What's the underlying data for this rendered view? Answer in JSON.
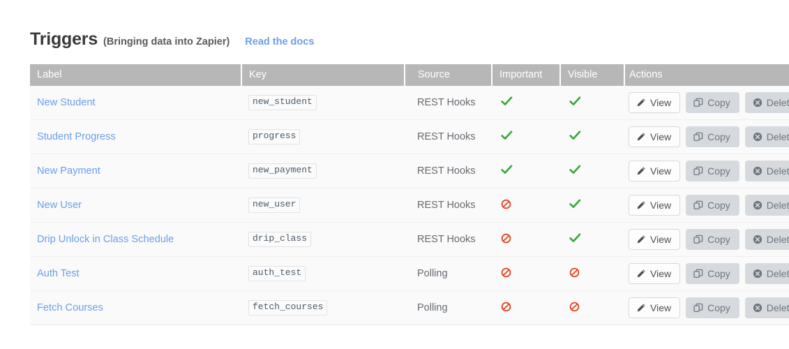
{
  "header": {
    "title": "Triggers",
    "subtitle": "(Bringing data into Zapier)",
    "docs_link": "Read the docs"
  },
  "table": {
    "columns": [
      "Label",
      "Key",
      "Source",
      "Important",
      "Visible",
      "Actions"
    ],
    "actions": {
      "view_label": "View",
      "copy_label": "Copy",
      "delete_label": "Delete",
      "view_icon": "pencil-icon",
      "copy_icon": "copy-icon",
      "delete_icon": "circle-x-icon"
    },
    "icons": {
      "yes": "check-icon",
      "no": "ban-icon"
    },
    "rows": [
      {
        "label": "New Student",
        "key": "new_student",
        "source": "REST Hooks",
        "important": "yes",
        "visible": "yes"
      },
      {
        "label": "Student Progress",
        "key": "progress",
        "source": "REST Hooks",
        "important": "yes",
        "visible": "yes"
      },
      {
        "label": "New Payment",
        "key": "new_payment",
        "source": "REST Hooks",
        "important": "yes",
        "visible": "yes"
      },
      {
        "label": "New User",
        "key": "new_user",
        "source": "REST Hooks",
        "important": "no",
        "visible": "yes"
      },
      {
        "label": "Drip Unlock in Class Schedule",
        "key": "drip_class",
        "source": "REST Hooks",
        "important": "no",
        "visible": "yes"
      },
      {
        "label": "Auth Test",
        "key": "auth_test",
        "source": "Polling",
        "important": "no",
        "visible": "no"
      },
      {
        "label": "Fetch Courses",
        "key": "fetch_courses",
        "source": "Polling",
        "important": "no",
        "visible": "no"
      }
    ]
  },
  "colors": {
    "link": "#6b9fe8",
    "header_bg": "#b7b7b7",
    "check_green": "#36a635",
    "ban_red": "#e8401f",
    "row_bg": "#fafafa"
  }
}
